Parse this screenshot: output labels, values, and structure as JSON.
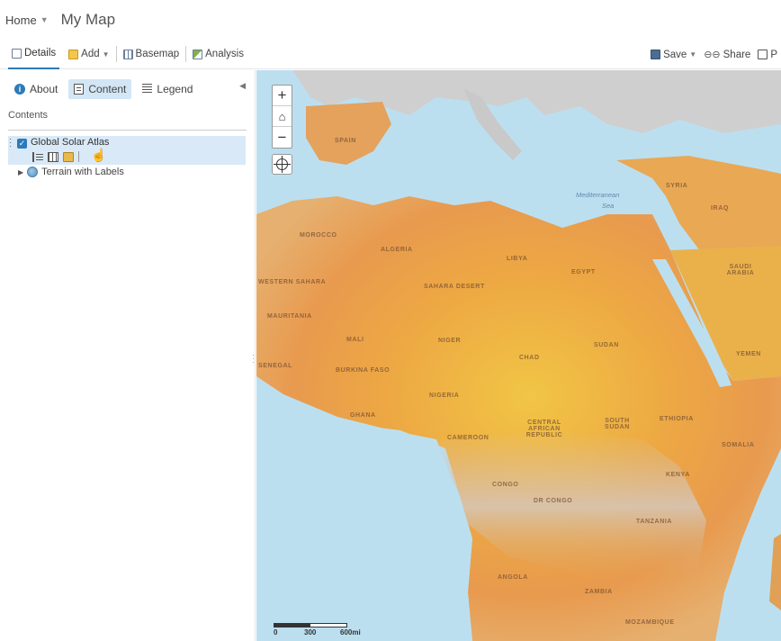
{
  "header": {
    "home_label": "Home",
    "home_caret": "▼",
    "title": "My Map"
  },
  "toolbar": {
    "details": "Details",
    "add": "Add",
    "basemap": "Basemap",
    "analysis": "Analysis",
    "save": "Save",
    "share": "Share",
    "print_partial": "P"
  },
  "sidebar": {
    "tabs": [
      {
        "label": "About",
        "selected": false
      },
      {
        "label": "Content",
        "selected": true
      },
      {
        "label": "Legend",
        "selected": false
      }
    ],
    "contents_heading": "Contents",
    "layers": [
      {
        "name": "Global Solar Atlas",
        "checked": true,
        "highlighted": true
      },
      {
        "name": "Terrain with Labels",
        "checked": false,
        "highlighted": false
      }
    ]
  },
  "map": {
    "zoom_in": "+",
    "zoom_out": "−",
    "labels": {
      "spain": "SPAIN",
      "algeria": "ALGERIA",
      "libya": "LIBYA",
      "morocco": "MOROCCO",
      "western_sahara": "WESTERN SAHARA",
      "mauritania": "MAURITANIA",
      "mali": "MALI",
      "niger": "NIGER",
      "chad": "CHAD",
      "sudan": "SUDAN",
      "egypt": "EGYPT",
      "nigeria": "NIGERIA",
      "burkina": "BURKINA FASO",
      "ghana": "GHANA",
      "cameroon": "CAMEROON",
      "car": "CENTRAL AFRICAN REPUBLIC",
      "south_sudan": "SOUTH SUDAN",
      "ethiopia": "ETHIOPIA",
      "somalia": "SOMALIA",
      "kenya": "KENYA",
      "congo": "CONGO",
      "dr_congo": "DR CONGO",
      "tanzania": "TANZANIA",
      "angola": "ANGOLA",
      "zambia": "ZAMBIA",
      "mozambique": "MOZAMBIQUE",
      "saudi": "SAUDI ARABIA",
      "yemen": "YEMEN",
      "syria": "SYRIA",
      "iraq": "IRAQ",
      "sahara": "SAHARA DESERT",
      "med_sea": "Mediterranean",
      "sea": "Sea",
      "senegal": "SENEGAL"
    },
    "scale": {
      "zero": "0",
      "mid": "300",
      "max": "600mi"
    }
  }
}
